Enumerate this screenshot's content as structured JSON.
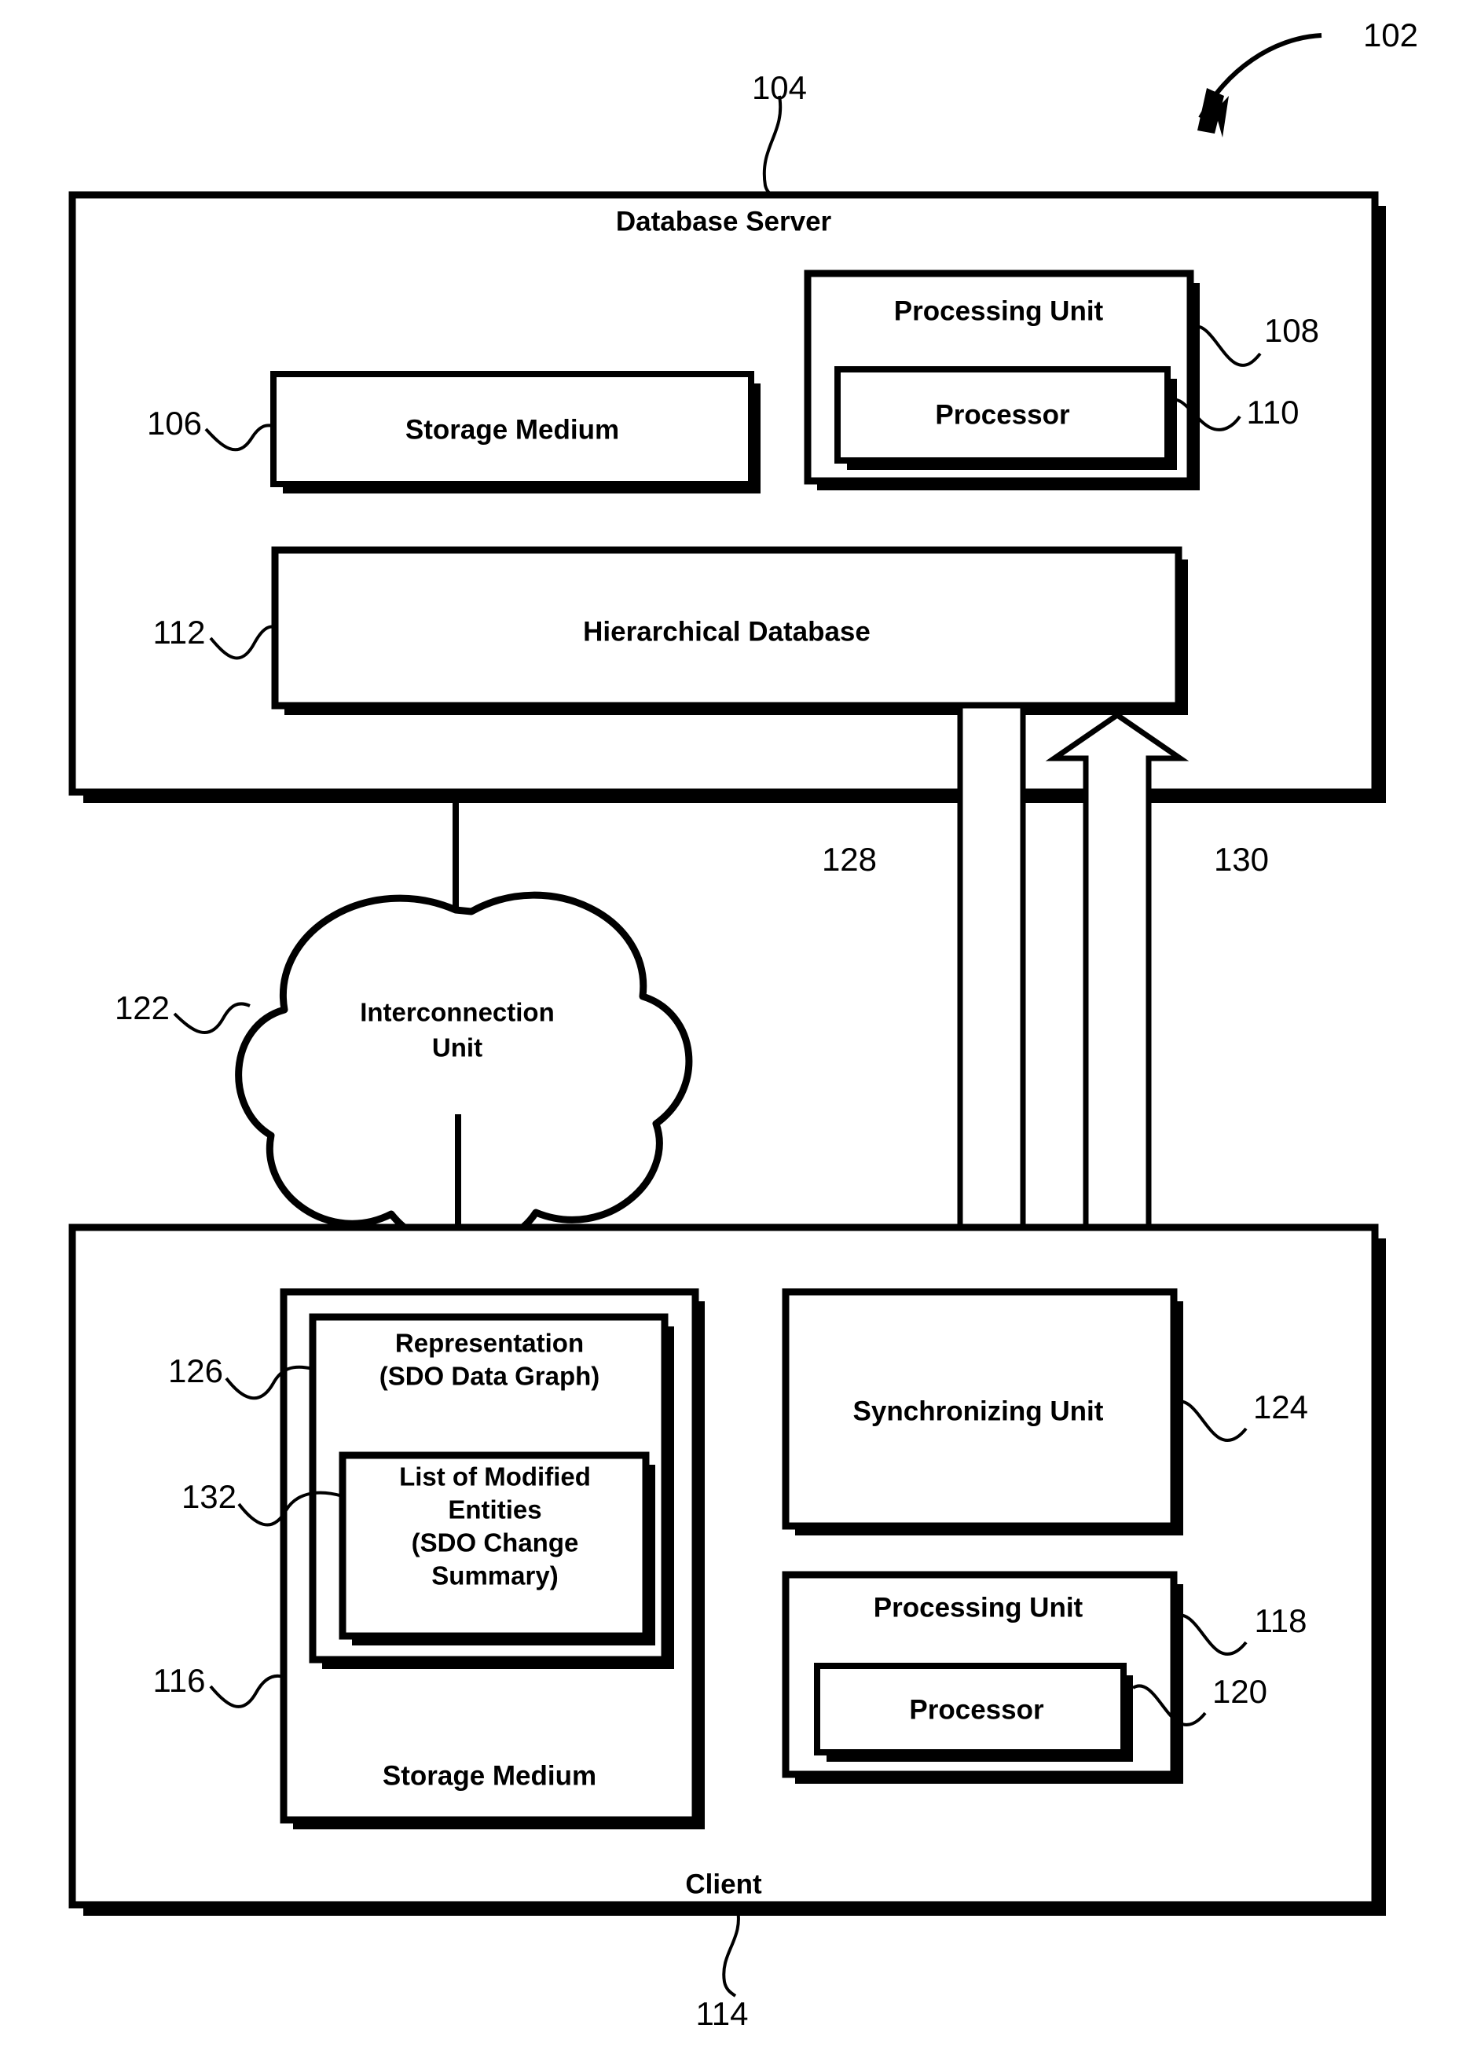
{
  "figure": {
    "system_ref": "102",
    "server": {
      "title": "Database Server",
      "ref": "104",
      "storage_medium": {
        "label": "Storage Medium",
        "ref": "106"
      },
      "processing_unit": {
        "label": "Processing Unit",
        "ref": "108"
      },
      "processor": {
        "label": "Processor",
        "ref": "110"
      },
      "hierarchical_database": {
        "label": "Hierarchical Database",
        "ref": "112"
      }
    },
    "interconnection": {
      "label_line1": "Interconnection",
      "label_line2": "Unit",
      "ref": "122"
    },
    "arrows": {
      "downlink_ref": "128",
      "uplink_ref": "130"
    },
    "client": {
      "title": "Client",
      "ref": "114",
      "storage_medium": {
        "label": "Storage Medium",
        "ref": "116"
      },
      "representation": {
        "label_line1": "Representation",
        "label_line2": "(SDO Data Graph)",
        "ref": "126"
      },
      "modified_entities": {
        "label_line1": "List of Modified",
        "label_line2": "Entities",
        "label_line3": "(SDO Change",
        "label_line4": "Summary)",
        "ref": "132"
      },
      "synchronizing_unit": {
        "label": "Synchronizing Unit",
        "ref": "124"
      },
      "processing_unit": {
        "label": "Processing Unit",
        "ref": "118"
      },
      "processor": {
        "label": "Processor",
        "ref": "120"
      }
    }
  }
}
